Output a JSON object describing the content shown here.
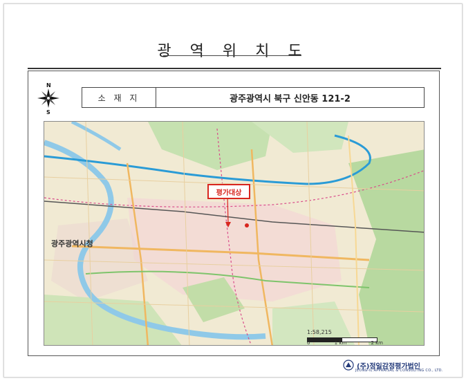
{
  "title": "광 역 위 치 도",
  "compass": {
    "north": "N",
    "south": "S"
  },
  "location": {
    "label": "소 재 지",
    "value": "광주광역시 북구 신안동 121-2"
  },
  "map": {
    "target_label": "평가대상",
    "city_label": "광주광역시청",
    "scale_text": "1:58,215",
    "scale_ticks": [
      "0",
      "1 km",
      "2 km"
    ]
  },
  "footer": {
    "company": "(주)정일감정평가법인",
    "company_en": "JEONG-IL APPRAISAL & CONSULTING CO., LTD."
  },
  "colors": {
    "target_red": "#d8261e",
    "highway_blue": "#2a9bd6",
    "river_blue": "#8fc9e8",
    "park_green": "#b8d9a0"
  }
}
